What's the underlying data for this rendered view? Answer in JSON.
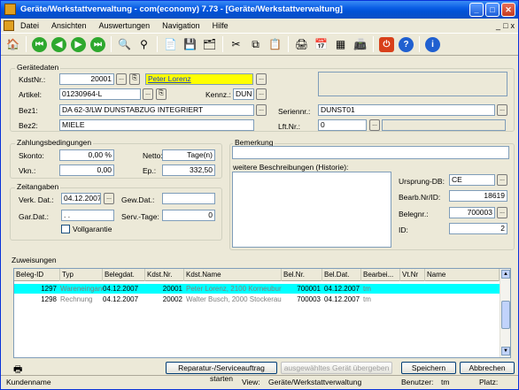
{
  "window": {
    "title": "Geräte/Werkstattverwaltung - com(economy) 7.73 - [Geräte/Werkstattverwaltung]"
  },
  "menu": [
    "Datei",
    "Ansichten",
    "Auswertungen",
    "Navigation",
    "Hilfe"
  ],
  "menu_right": [
    "_",
    "□",
    "x"
  ],
  "form": {
    "geraetedaten": "Gerätedaten",
    "kdstnr_label": "KdstNr.:",
    "kdstnr_value": "20001",
    "kunde_name": "Peter Lorenz",
    "artikel_label": "Artikel:",
    "artikel_value": "01230964-L",
    "kennz_label": "Kennz.:",
    "kennz_value": "DUN",
    "bez1_label": "Bez1:",
    "bez1_value": "DA 62-3/LW DUNSTABZUG INTEGRIERT",
    "bez2_label": "Bez2:",
    "bez2_value": "MIELE",
    "seriennr_label": "Seriennr.:",
    "seriennr_value": "DUNST01",
    "lftnr_label": "Lft.Nr.:",
    "lftnr_value": "0",
    "zahlung": "Zahlungsbedingungen",
    "skonto_label": "Skonto:",
    "skonto_value": "0,00 %",
    "netto_label": "Netto:",
    "netto_value": "Tage(n)",
    "vkn_label": "Vkn.:",
    "vkn_value": "0,00",
    "ep_label": "Ep.:",
    "ep_value": "332,50",
    "zeitangaben": "Zeitangaben",
    "verk_label": "Verk. Dat.:",
    "verk_value": "04.12.2007",
    "gewdat_label": "Gew.Dat.:",
    "gewdat_value": "",
    "gardat_label": "Gar.Dat.:",
    "gardat_value": " .  .",
    "servtage_label": "Serv.-Tage:",
    "servtage_value": "0",
    "vollgarantie_label": "Vollgarantie",
    "bemerkung": "Bemerkung",
    "weitere": "weitere Beschreibungen (Historie):",
    "ursprung_label": "Ursprung-DB:",
    "ursprung_value": "CE",
    "bearb_label": "Bearb.Nr/ID:",
    "bearb_value": "18619",
    "belegnr_label": "Belegnr.:",
    "belegnr_value": "700003",
    "id_label": "ID:",
    "id_value": "2"
  },
  "zuweisungen": {
    "title": "Zuweisungen",
    "columns": [
      "Beleg-ID",
      "Typ",
      "Belegdat.",
      "Kdst.Nr.",
      "Kdst.Name",
      "Bel.Nr.",
      "Bel.Dat.",
      "Bearbei...",
      "Vt.Nr",
      "Name"
    ],
    "rows": [
      [
        "1297",
        "Wareneingang",
        "04.12.2007",
        "20001",
        "Peter Lorenz, 2100  Korneuburg",
        "700001",
        "04.12.2007",
        "tm",
        "",
        ""
      ],
      [
        "1298",
        "Rechnung",
        "04.12.2007",
        "20002",
        "Walter Busch, 2000  Stockerau",
        "700003",
        "04.12.2007",
        "tm",
        "",
        ""
      ]
    ]
  },
  "buttons": {
    "reparatur": "Reparatur-/Serviceauftrag starten",
    "uebergeben": "ausgewähltes Gerät übergeben",
    "speichern": "Speichern",
    "abbrechen": "Abbrechen"
  },
  "statusbar": {
    "kunde": "Kundenname",
    "view_label": "View:",
    "view_value": "Geräte/Werkstattverwaltung",
    "user_label": "Benutzer:",
    "user_value": "tm",
    "platz_label": "Platz:"
  }
}
